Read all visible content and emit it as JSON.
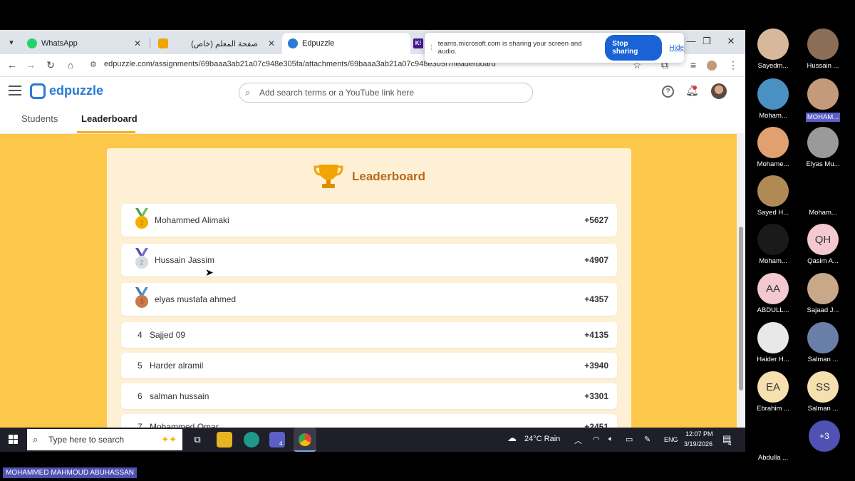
{
  "tabs": [
    {
      "label": "WhatsApp",
      "favicon_color": "#25d366"
    },
    {
      "label": "صفحة المعلم (خاص)",
      "favicon_color": "#f2a400"
    },
    {
      "label": "Edpuzzle",
      "favicon_color": "#2a7bd4"
    },
    {
      "label": "K!",
      "favicon_color": "#46178f"
    }
  ],
  "share_notice": {
    "text": "teams.microsoft.com is sharing your screen and audio.",
    "stop_label": "Stop sharing",
    "hide_label": "Hide"
  },
  "address": {
    "url": "edpuzzle.com/assignments/69baaa3ab21a07c948e305fa/attachments/69baaa3ab21a07c948e305f7/leaderboard"
  },
  "edpuzzle": {
    "logo": "edpuzzle",
    "search_placeholder": "Add search terms or a YouTube link here",
    "help": "?"
  },
  "subtabs": [
    "Students",
    "Leaderboard"
  ],
  "leaderboard": {
    "title": "Leaderboard",
    "rows": [
      {
        "rank": "",
        "medal": "gold",
        "medal_num": "1",
        "name": "Mohammed Alimaki",
        "score": "+5627"
      },
      {
        "rank": "",
        "medal": "silver",
        "medal_num": "2",
        "name": "Hussain Jassim",
        "score": "+4907"
      },
      {
        "rank": "",
        "medal": "bronze",
        "medal_num": "3",
        "name": "elyas mustafa ahmed",
        "score": "+4357"
      },
      {
        "rank": "4",
        "medal": "",
        "name": "Sajjed 09",
        "score": "+4135"
      },
      {
        "rank": "5",
        "medal": "",
        "name": "Harder alramil",
        "score": "+3940"
      },
      {
        "rank": "6",
        "medal": "",
        "name": "salman hussain",
        "score": "+3301"
      },
      {
        "rank": "7",
        "medal": "",
        "name": "Mohammed Omar",
        "score": "+2451"
      }
    ]
  },
  "taskbar": {
    "search_placeholder": "Type here to search",
    "weather": "24°C  Rain",
    "lang": "ENG",
    "time": "12:07 PM",
    "date": "3/19/2026",
    "teams_badge": "4",
    "notif_badge": "4"
  },
  "participants": [
    {
      "name": "Sayedm...",
      "initials": "",
      "color": "#d8b89a"
    },
    {
      "name": "Hussain ...",
      "initials": "",
      "color": "#8b6e55"
    },
    {
      "name": "Moham...",
      "initials": "",
      "color": "#4a90c2"
    },
    {
      "name": "MOHAM...",
      "initials": "",
      "color": "#c49a7c",
      "highlight": true
    },
    {
      "name": "Mohame...",
      "initials": "",
      "color": "#e0a070"
    },
    {
      "name": "Elyas Mu...",
      "initials": "",
      "color": "#9a9a9a"
    },
    {
      "name": "Sayed H...",
      "initials": "",
      "color": "#b08a55"
    },
    {
      "name": "Moham...",
      "initials": "",
      "color": "#000000"
    },
    {
      "name": "Moham...",
      "initials": "",
      "color": "#1a1a1a"
    },
    {
      "name": "Qasim A...",
      "initials": "QH",
      "color": "#f3c9cf"
    },
    {
      "name": "ABDULL...",
      "initials": "AA",
      "color": "#f3c9cf"
    },
    {
      "name": "Sajaad J...",
      "initials": "",
      "color": "#c8a888"
    },
    {
      "name": "Haider H...",
      "initials": "",
      "color": "#e8e8e8"
    },
    {
      "name": "Salman ...",
      "initials": "",
      "color": "#6a7fa8"
    },
    {
      "name": "Ebrahim ...",
      "initials": "EA",
      "color": "#f6e0b0"
    },
    {
      "name": "Salman ...",
      "initials": "SS",
      "color": "#f6e0b0"
    },
    {
      "name": "Abdulla ...",
      "initials": "",
      "color": "#000000"
    }
  ],
  "more_participants": "+3",
  "presenter": "MOHAMMED MAHMOUD ABUHASSAN"
}
